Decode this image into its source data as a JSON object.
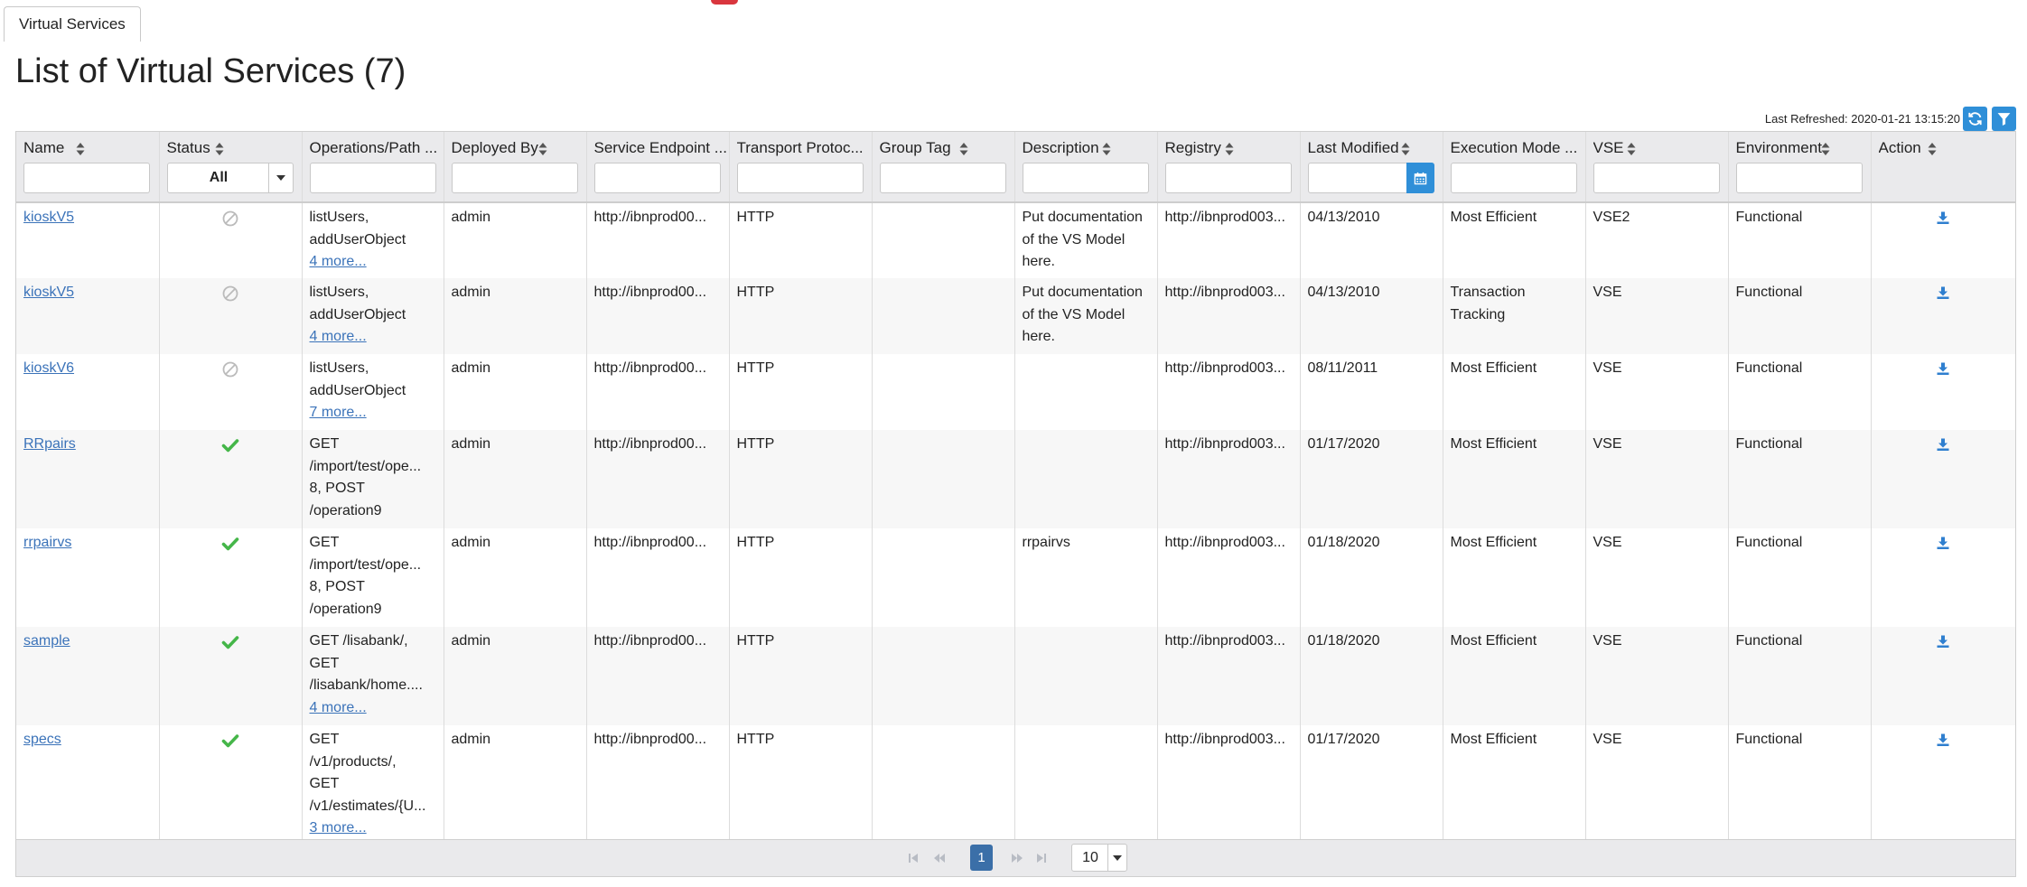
{
  "tabs": [
    {
      "label": "Virtual Services"
    }
  ],
  "page_title": "List of Virtual Services (7)",
  "last_refreshed": "Last Refreshed: 2020-01-21 13:15:20",
  "toolbar": {
    "refresh_icon": "refresh-icon",
    "filter_icon": "filter-icon"
  },
  "colors": {
    "accent": "#2f8fd8",
    "link": "#3b73b9",
    "ok": "#45b649",
    "disabled": "#bbbbbb",
    "page_current": "#3b6fa8",
    "top_mark": "#d9363e"
  },
  "columns": [
    {
      "label": "Name",
      "filter": "text"
    },
    {
      "label": "Status",
      "filter": "select",
      "value": "All"
    },
    {
      "label": "Operations/Path ...",
      "filter": "text"
    },
    {
      "label": "Deployed By",
      "filter": "text"
    },
    {
      "label": "Service Endpoint ...",
      "filter": "text"
    },
    {
      "label": "Transport Protoc...",
      "filter": "text"
    },
    {
      "label": "Group Tag",
      "filter": "text"
    },
    {
      "label": "Description",
      "filter": "text"
    },
    {
      "label": "Registry",
      "filter": "text"
    },
    {
      "label": "Last Modified",
      "filter": "date"
    },
    {
      "label": "Execution Mode ...",
      "filter": "text"
    },
    {
      "label": "VSE",
      "filter": "text"
    },
    {
      "label": "Environment",
      "filter": "text"
    },
    {
      "label": "Action",
      "filter": "none"
    }
  ],
  "rows": [
    {
      "name": "kioskV5",
      "status": "stopped",
      "ops": [
        "listUsers,",
        "addUserObject"
      ],
      "more": "4 more...",
      "deployed_by": "admin",
      "endpoint": "http://ibnprod00...",
      "transport": "HTTP",
      "group_tag": "",
      "description": "Put documentation of the VS Model here.",
      "registry": "http://ibnprod003...",
      "last_modified": "04/13/2010",
      "exec_mode": "Most Efficient",
      "vse": "VSE2",
      "environment": "Functional"
    },
    {
      "name": "kioskV5",
      "status": "stopped",
      "ops": [
        "listUsers,",
        "addUserObject"
      ],
      "more": "4 more...",
      "deployed_by": "admin",
      "endpoint": "http://ibnprod00...",
      "transport": "HTTP",
      "group_tag": "",
      "description": "Put documentation of the VS Model here.",
      "registry": "http://ibnprod003...",
      "last_modified": "04/13/2010",
      "exec_mode": "Transaction Tracking",
      "vse": "VSE",
      "environment": "Functional"
    },
    {
      "name": "kioskV6",
      "status": "stopped",
      "ops": [
        "listUsers,",
        "addUserObject"
      ],
      "more": "7 more...",
      "deployed_by": "admin",
      "endpoint": "http://ibnprod00...",
      "transport": "HTTP",
      "group_tag": "",
      "description": "",
      "registry": "http://ibnprod003...",
      "last_modified": "08/11/2011",
      "exec_mode": "Most Efficient",
      "vse": "VSE",
      "environment": "Functional"
    },
    {
      "name": "RRpairs",
      "status": "running",
      "ops": [
        "GET",
        "/import/test/ope...",
        "8, POST",
        "/operation9"
      ],
      "more": "",
      "deployed_by": "admin",
      "endpoint": "http://ibnprod00...",
      "transport": "HTTP",
      "group_tag": "",
      "description": "",
      "registry": "http://ibnprod003...",
      "last_modified": "01/17/2020",
      "exec_mode": "Most Efficient",
      "vse": "VSE",
      "environment": "Functional"
    },
    {
      "name": "rrpairvs",
      "status": "running",
      "ops": [
        "GET",
        "/import/test/ope...",
        "8, POST",
        "/operation9"
      ],
      "more": "",
      "deployed_by": "admin",
      "endpoint": "http://ibnprod00...",
      "transport": "HTTP",
      "group_tag": "",
      "description": "rrpairvs",
      "registry": "http://ibnprod003...",
      "last_modified": "01/18/2020",
      "exec_mode": "Most Efficient",
      "vse": "VSE",
      "environment": "Functional"
    },
    {
      "name": "sample",
      "status": "running",
      "ops": [
        "GET /lisabank/,",
        "GET",
        "/lisabank/home...."
      ],
      "more": "4 more...",
      "deployed_by": "admin",
      "endpoint": "http://ibnprod00...",
      "transport": "HTTP",
      "group_tag": "",
      "description": "",
      "registry": "http://ibnprod003...",
      "last_modified": "01/18/2020",
      "exec_mode": "Most Efficient",
      "vse": "VSE",
      "environment": "Functional"
    },
    {
      "name": "specs",
      "status": "running",
      "ops": [
        "GET",
        "/v1/products/,",
        "GET",
        "/v1/estimates/{U..."
      ],
      "more": "3 more...",
      "deployed_by": "admin",
      "endpoint": "http://ibnprod00...",
      "transport": "HTTP",
      "group_tag": "",
      "description": "",
      "registry": "http://ibnprod003...",
      "last_modified": "01/17/2020",
      "exec_mode": "Most Efficient",
      "vse": "VSE",
      "environment": "Functional"
    }
  ],
  "pagination": {
    "current_page": "1",
    "page_size": "10"
  }
}
